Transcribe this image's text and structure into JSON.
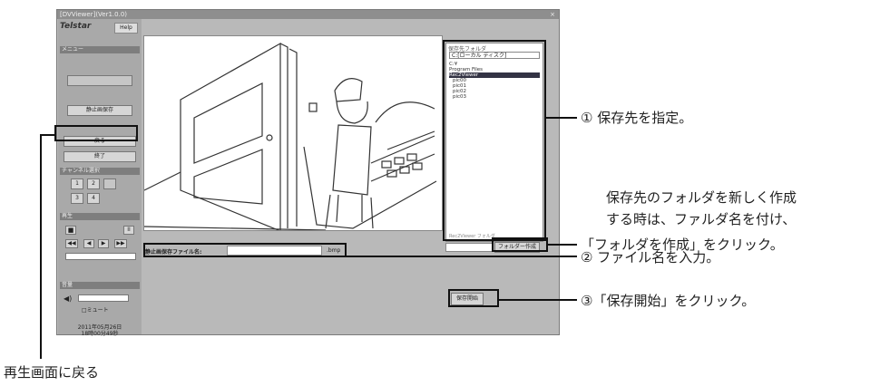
{
  "window": {
    "title": "[DVViewer](Ver1.0.0)",
    "close": "×"
  },
  "left_panel": {
    "logo": "Telstar",
    "help": "Help",
    "menu_header": "メニュー",
    "menu_btn1": "",
    "still_save_btn": "静止画保存",
    "back_btn": "戻る",
    "exit_btn": "終了",
    "channel_header": "チャンネル選択",
    "channel_buttons": [
      "1",
      "2",
      "",
      "3",
      "4"
    ],
    "playback_header": "再生",
    "volume_header": "音量",
    "mute_label": "ミュート",
    "date": "2011年05月26日",
    "time": "18時00分49秒"
  },
  "folder_panel": {
    "title": "保存先フォルダ",
    "drive": "C:[ローカル ディスク]",
    "tree": [
      "C:¥",
      "Program Files",
      "Rec2Viewer",
      "pic00",
      "pic01",
      "pic02",
      "pic03"
    ],
    "selected_index": 2,
    "footer": "Rec2Viewer フォルダ",
    "create_folder_btn": "フォルダー作成"
  },
  "file": {
    "label": "静止画保存ファイル名:",
    "value": "",
    "ext": ".bmp"
  },
  "save_start_btn": "保存開始",
  "annotations": {
    "a1": "① 保存先を指定。",
    "note_l1": "保存先のフォルダを新しく作成",
    "note_l2": "する時は、ファルダ名を付け、",
    "note_l3": "「フォルダを作成」をクリック。",
    "a2": "② ファイル名を入力。",
    "a3": "③「保存開始」をクリック。",
    "a4": "再生画面に戻る"
  }
}
